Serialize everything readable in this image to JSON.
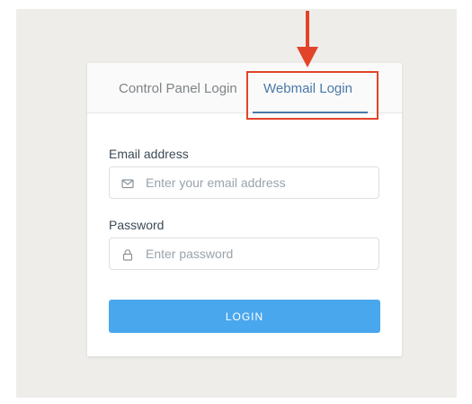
{
  "tabs": [
    {
      "label": "Control Panel Login",
      "active": false
    },
    {
      "label": "Webmail Login",
      "active": true
    }
  ],
  "form": {
    "email": {
      "label": "Email address",
      "placeholder": "Enter your email address",
      "value": "",
      "icon": "envelope-icon"
    },
    "password": {
      "label": "Password",
      "placeholder": "Enter password",
      "value": "",
      "icon": "lock-icon"
    },
    "login_label": "LOGIN"
  },
  "annotation": {
    "arrow_icon": "red-arrow-down-icon",
    "highlight_target": "tab-webmail-login",
    "color": "#e2442a"
  },
  "colors": {
    "accent": "#4a79a8",
    "button": "#49a7ee",
    "backdrop": "#eeedea",
    "annotation": "#e2442a"
  }
}
